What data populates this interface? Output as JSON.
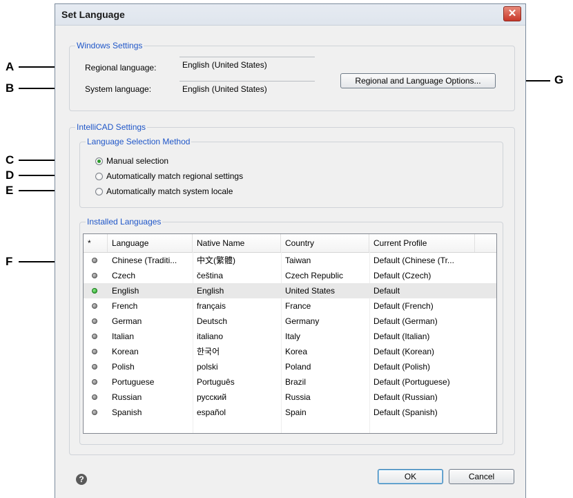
{
  "callouts": {
    "a": "A",
    "b": "B",
    "c": "C",
    "d": "D",
    "e": "E",
    "f": "F",
    "g": "G"
  },
  "dialog": {
    "title": "Set Language",
    "close_glyph": "✕"
  },
  "windows_settings": {
    "group_label": "Windows Settings",
    "regional_label": "Regional language:",
    "regional_value": "English (United States)",
    "system_label": "System language:",
    "system_value": "English (United States)",
    "options_button": "Regional and Language Options..."
  },
  "intellicad_settings": {
    "group_label": "IntelliCAD Settings",
    "method_group_label": "Language Selection Method",
    "radios": [
      {
        "label": "Manual selection",
        "selected": true
      },
      {
        "label": "Automatically match regional settings",
        "selected": false
      },
      {
        "label": "Automatically match system locale",
        "selected": false
      }
    ],
    "installed_label": "Installed Languages"
  },
  "table": {
    "headers": [
      "*",
      "Language",
      "Native Name",
      "Country",
      "Current Profile"
    ],
    "rows": [
      {
        "language": "Chinese (Traditi...",
        "native": "中文(繁體)",
        "country": "Taiwan",
        "profile": "Default (Chinese (Tr...",
        "active": false
      },
      {
        "language": "Czech",
        "native": "čeština",
        "country": "Czech Republic",
        "profile": "Default (Czech)",
        "active": false
      },
      {
        "language": "English",
        "native": "English",
        "country": "United States",
        "profile": "Default",
        "active": true
      },
      {
        "language": "French",
        "native": "français",
        "country": "France",
        "profile": "Default (French)",
        "active": false
      },
      {
        "language": "German",
        "native": "Deutsch",
        "country": "Germany",
        "profile": "Default (German)",
        "active": false
      },
      {
        "language": "Italian",
        "native": "italiano",
        "country": "Italy",
        "profile": "Default (Italian)",
        "active": false
      },
      {
        "language": "Korean",
        "native": "한국어",
        "country": "Korea",
        "profile": "Default (Korean)",
        "active": false
      },
      {
        "language": "Polish",
        "native": "polski",
        "country": "Poland",
        "profile": "Default (Polish)",
        "active": false
      },
      {
        "language": "Portuguese",
        "native": "Português",
        "country": "Brazil",
        "profile": "Default (Portuguese)",
        "active": false
      },
      {
        "language": "Russian",
        "native": "русский",
        "country": "Russia",
        "profile": "Default (Russian)",
        "active": false
      },
      {
        "language": "Spanish",
        "native": "español",
        "country": "Spain",
        "profile": "Default (Spanish)",
        "active": false
      }
    ]
  },
  "footer": {
    "help_glyph": "?",
    "ok_label": "OK",
    "cancel_label": "Cancel"
  },
  "colors": {
    "group_label": "#1f56c8",
    "active_dot": "#22a022",
    "inactive_dot": "#6e6e6e",
    "close_button": "#c8382a"
  }
}
